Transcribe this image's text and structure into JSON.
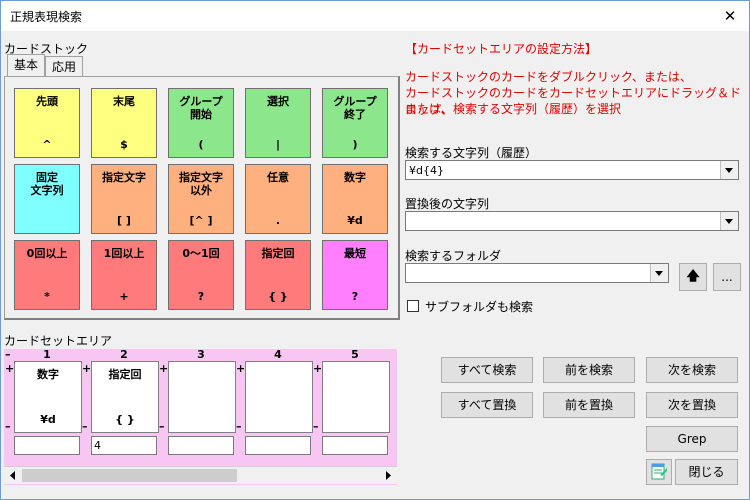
{
  "window": {
    "title": "正規表現検索",
    "close": "✕"
  },
  "stock": {
    "label": "カードストック",
    "tabs": [
      "基本",
      "応用"
    ]
  },
  "cards": [
    {
      "label": "先頭",
      "sym": "^",
      "color": "yellow"
    },
    {
      "label": "末尾",
      "sym": "$",
      "color": "yellow"
    },
    {
      "label": "グループ\n開始",
      "sym": "(",
      "color": "green"
    },
    {
      "label": "選択",
      "sym": "|",
      "color": "green"
    },
    {
      "label": "グループ\n終了",
      "sym": ")",
      "color": "green"
    },
    {
      "label": "固定\n文字列",
      "sym": "",
      "color": "cyan"
    },
    {
      "label": "指定文字",
      "sym": "[     ]",
      "color": "orange"
    },
    {
      "label": "指定文字\n以外",
      "sym": "[^    ]",
      "color": "orange"
    },
    {
      "label": "任意",
      "sym": ".",
      "color": "orange"
    },
    {
      "label": "数字",
      "sym": "¥d",
      "color": "orange"
    },
    {
      "label": "0回以上",
      "sym": "*",
      "color": "red"
    },
    {
      "label": "1回以上",
      "sym": "+",
      "color": "red"
    },
    {
      "label": "0～1回",
      "sym": "?",
      "color": "red"
    },
    {
      "label": "指定回",
      "sym": "{    }",
      "color": "red"
    },
    {
      "label": "最短",
      "sym": "?",
      "color": "magenta"
    }
  ],
  "instructions": {
    "heading": "【カードセットエリアの設定方法】",
    "line1": "カードストックのカードをダブルクリック、または、",
    "line2": "カードストックのカードをカードセットエリアにドラッグ＆ドロップ、",
    "line3": "または、検索する文字列（履歴）を選択"
  },
  "search": {
    "label": "検索する文字列（履歴）",
    "value": "¥d{4}"
  },
  "replace": {
    "label": "置換後の文字列",
    "value": ""
  },
  "folder": {
    "label": "検索するフォルダ",
    "value": "",
    "up": "🡅",
    "browse": "..."
  },
  "subfolder": {
    "label": "サブフォルダも検索"
  },
  "setarea": {
    "label": "カードセットエリア",
    "slots": [
      {
        "num": "1",
        "label": "数字",
        "sym": "¥d",
        "color": "orange",
        "param": ""
      },
      {
        "num": "2",
        "label": "指定回",
        "sym": "{    }",
        "color": "red",
        "param": "4"
      },
      {
        "num": "3",
        "label": "",
        "sym": "",
        "color": "",
        "param": ""
      },
      {
        "num": "4",
        "label": "",
        "sym": "",
        "color": "",
        "param": ""
      },
      {
        "num": "5",
        "label": "",
        "sym": "",
        "color": "",
        "param": ""
      }
    ]
  },
  "buttons": {
    "search_all": "すべて検索",
    "search_prev": "前を検索",
    "search_next": "次を検索",
    "replace_all": "すべて置換",
    "replace_prev": "前を置換",
    "replace_next": "次を置換",
    "grep": "Grep",
    "close": "閉じる"
  },
  "colors": {
    "yellow": "#ffff7f",
    "green": "#8ce68c",
    "cyan": "#7fffff",
    "orange": "#ffb07f",
    "red": "#ff7a7a",
    "magenta": "#ff7fff",
    "instruction_text": "#e00000",
    "setarea_bg": "#f7c6f2"
  }
}
